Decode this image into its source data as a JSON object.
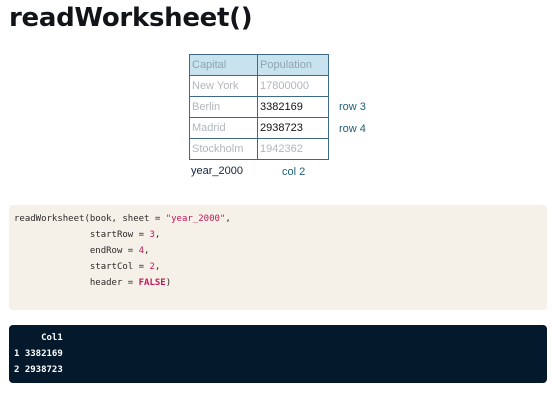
{
  "title": "readWorksheet()",
  "table": {
    "headers": [
      "Capital",
      "Population"
    ],
    "rows": [
      [
        "New York",
        "17800000"
      ],
      [
        "Berlin",
        "3382169"
      ],
      [
        "Madrid",
        "2938723"
      ],
      [
        "Stockholm",
        "1942362"
      ]
    ]
  },
  "annotations": {
    "row3": "row 3",
    "row4": "row 4",
    "col2": "col 2",
    "sheet": "year_2000"
  },
  "code": {
    "l1_a": "readWorksheet(book, sheet = ",
    "l1_str": "\"year_2000\"",
    "l1_b": ",",
    "l2_a": "              startRow = ",
    "l2_num": "3",
    "l2_b": ",",
    "l3_a": "              endRow = ",
    "l3_num": "4",
    "l3_b": ",",
    "l4_a": "              startCol = ",
    "l4_num": "2",
    "l4_b": ",",
    "l5_a": "              header = ",
    "l5_kw": "FALSE",
    "l5_b": ")"
  },
  "output": {
    "header": "     Col1",
    "row1": "1 3382169",
    "row2": "2 2938723"
  },
  "colors": {
    "table_header_bg": "#c8e3ef",
    "table_border": "#3d6b86",
    "annotation": "#1e5f7a",
    "code_bg": "#f5f0e8",
    "code_highlight": "#c2185b",
    "console_bg": "#05192d"
  }
}
